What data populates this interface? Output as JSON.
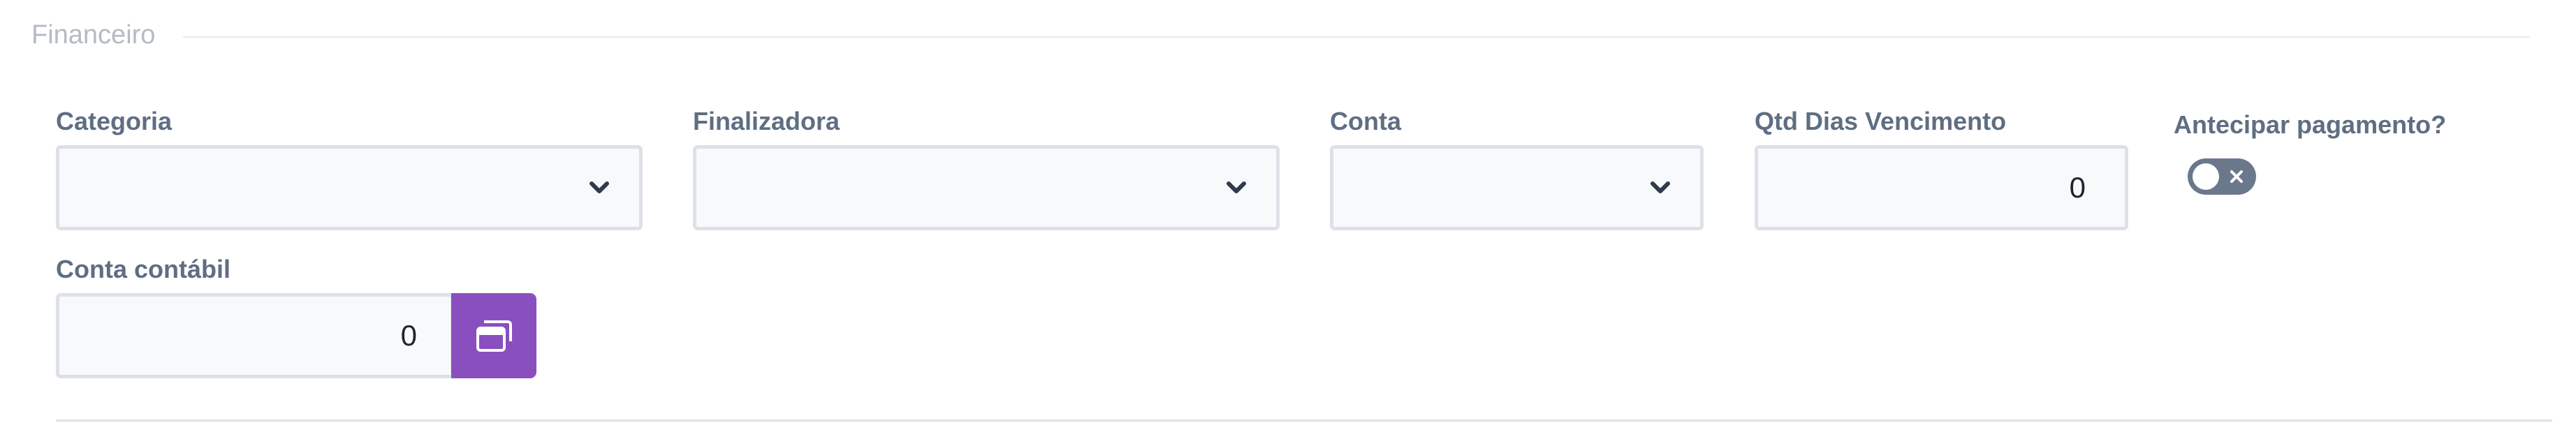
{
  "section": {
    "title": "Financeiro"
  },
  "fields": {
    "categoria": {
      "label": "Categoria",
      "value": ""
    },
    "finalizadora": {
      "label": "Finalizadora",
      "value": ""
    },
    "conta": {
      "label": "Conta",
      "value": ""
    },
    "qtd_dias": {
      "label": "Qtd Dias Vencimento",
      "value": "0"
    },
    "antecipar": {
      "label": "Antecipar pagamento?",
      "checked": false
    },
    "conta_contabil": {
      "label": "Conta contábil",
      "value": "0"
    }
  },
  "icons": {
    "dropdown": "chevron-down-icon",
    "toggle_off": "close-icon",
    "lookup": "window-stack-icon"
  },
  "colors": {
    "accent": "#8a4fbf",
    "toggle_off": "#6b788b",
    "label": "#5f6e82",
    "legend": "#b4bbc6"
  }
}
